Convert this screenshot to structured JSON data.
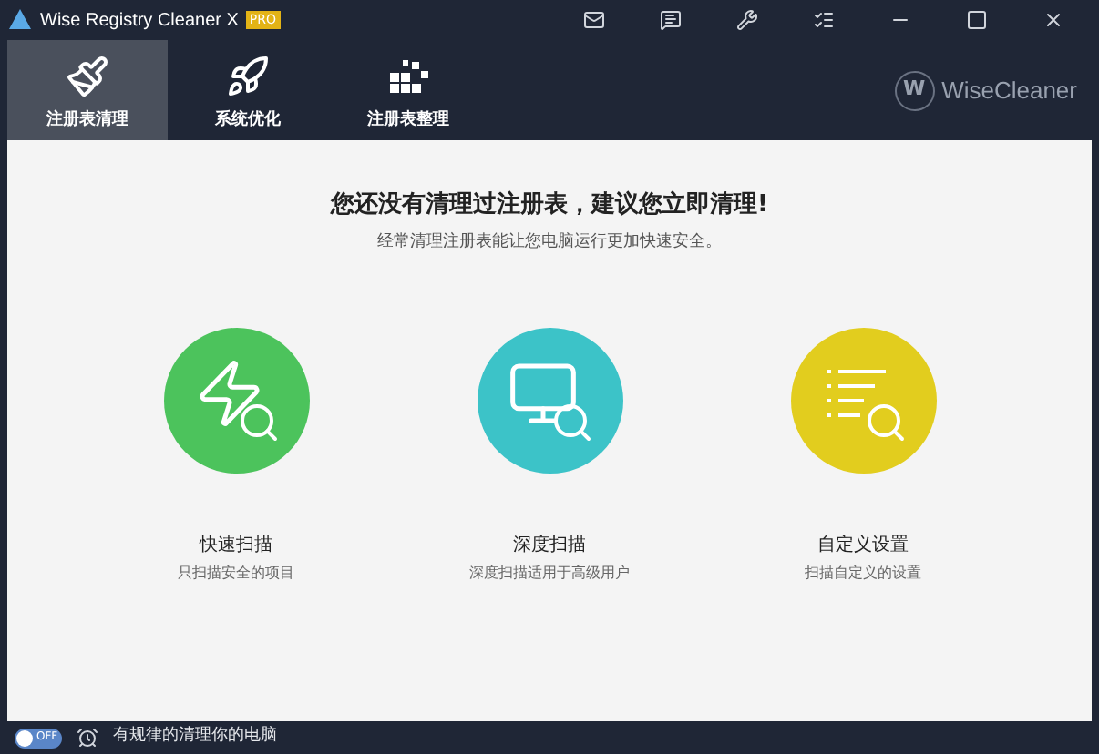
{
  "window": {
    "title": "Wise Registry Cleaner X",
    "badge": "PRO"
  },
  "tabs": [
    {
      "label": "注册表清理",
      "selected": true
    },
    {
      "label": "系统优化",
      "selected": false
    },
    {
      "label": "注册表整理",
      "selected": false
    }
  ],
  "brand": {
    "logo_letter": "W",
    "name": "WiseCleaner"
  },
  "heading": "您还没有清理过注册表，建议您立即清理!",
  "subheading": "经常清理注册表能让您电脑运行更加快速安全。",
  "scan_options": [
    {
      "kind": "quick",
      "title": "快速扫描",
      "description": "只扫描安全的项目",
      "color": "#4cc35c"
    },
    {
      "kind": "deep",
      "title": "深度扫描",
      "description": "深度扫描适用于高级用户",
      "color": "#3cc3c8"
    },
    {
      "kind": "custom",
      "title": "自定义设置",
      "description": "扫描自定义的设置",
      "color": "#e2cd1e"
    }
  ],
  "status_bar": {
    "toggle": {
      "label": "OFF",
      "on": false
    },
    "text": "有规律的清理你的电脑"
  }
}
